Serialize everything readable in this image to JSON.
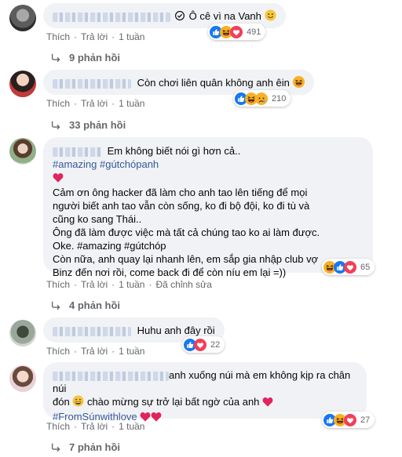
{
  "comments": [
    {
      "text": "Ô cê vì na Vanh",
      "actions": {
        "like": "Thích",
        "reply": "Trả lời",
        "time": "1 tuần"
      },
      "reaction_count": "491",
      "replies": "9 phản hồi"
    },
    {
      "text": "Còn chơi liên quân không anh êin",
      "actions": {
        "like": "Thích",
        "reply": "Trả lời",
        "time": "1 tuần"
      },
      "reaction_count": "210",
      "replies": "33 phản hồi"
    },
    {
      "lines": [
        "Em không biết nói gì hơn cả..",
        "#amazing #gútchópanh",
        "Cảm ơn ông hacker đã làm cho anh tao lên tiếng để mọi",
        "người biết anh tao vẫn còn sống, ko đi bộ đội, ko đi tù và",
        "cũng ko sang Thái..",
        "Ông đã làm được việc mà tất cả chúng tao ko ai làm được.",
        "Oke. #amazing #gútchóp",
        "Còn nữa, anh quay lại nhanh lên, em sắp gia nhập club vợ",
        "Binz đến nơi rồi, come back đi để còn níu em lại =))"
      ],
      "actions": {
        "like": "Thích",
        "reply": "Trả lời",
        "time": "1 tuần",
        "edited": "Đã chỉnh sửa"
      },
      "reaction_count": "65",
      "replies": "4 phản hồi"
    },
    {
      "text": "Huhu anh đây rồi",
      "actions": {
        "like": "Thích",
        "reply": "Trả lời",
        "time": "1 tuần"
      },
      "reaction_count": "22"
    },
    {
      "line1": "anh xuống núi mà em không kịp ra chân núi",
      "line2a": "đón",
      "line2b": "chào mừng sự trở lại bất ngờ của anh",
      "line3": "#FromSúnwithlove",
      "actions": {
        "like": "Thích",
        "reply": "Trả lời",
        "time": "1 tuần"
      },
      "reaction_count": "27",
      "replies": "7 phản hồi"
    }
  ],
  "colors": {
    "like": "#1877f2",
    "love": "#f33e58",
    "haha": "#f7b125",
    "link": "#385898",
    "meta": "#65676b",
    "bubble": "#f0f2f5"
  },
  "icons": [
    "like-icon",
    "love-icon",
    "haha-icon",
    "verified-icon",
    "reply-arrow-icon"
  ]
}
